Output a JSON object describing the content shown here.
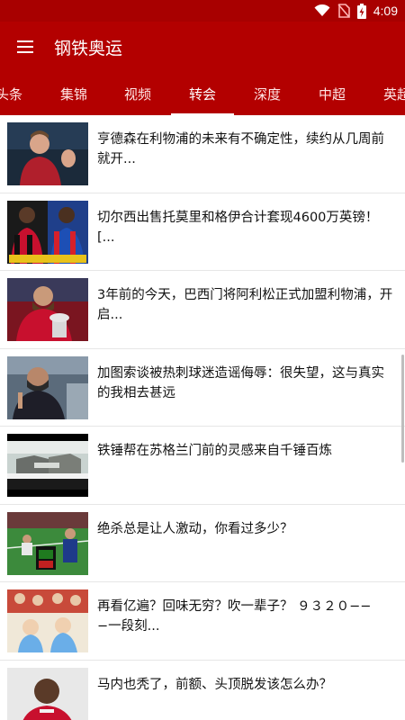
{
  "status_bar": {
    "time": "4:09",
    "icons": [
      "wifi-icon",
      "no-sim-icon",
      "battery-charging-icon"
    ]
  },
  "app_bar": {
    "title": "钢铁奥运",
    "menu_icon": "hamburger-menu-icon"
  },
  "tabs": [
    {
      "label": "头条",
      "active": false
    },
    {
      "label": "集锦",
      "active": false
    },
    {
      "label": "视频",
      "active": false
    },
    {
      "label": "转会",
      "active": true
    },
    {
      "label": "深度",
      "active": false
    },
    {
      "label": "中超",
      "active": false
    },
    {
      "label": "英超",
      "active": false
    }
  ],
  "news": [
    {
      "title": "亨德森在利物浦的未来有不确定性，续约从几周前就开..."
    },
    {
      "title": "切尔西出售托莫里和格伊合计套现4600万英镑！[..."
    },
    {
      "title": "3年前的今天，巴西门将阿利松正式加盟利物浦，开启..."
    },
    {
      "title": "加图索谈被热刺球迷造谣侮辱：很失望，这与真实的我相去甚远"
    },
    {
      "title": "铁锤帮在苏格兰门前的灵感来自千锤百炼"
    },
    {
      "title": "绝杀总是让人激动，你看过多少？"
    },
    {
      "title": "再看亿遍？回味无穷？吹一辈子？ ９３２０−−−一段刻..."
    },
    {
      "title": "马内也秃了，前额、头顶脱发该怎么办？"
    }
  ],
  "colors": {
    "primary": "#b30000",
    "status_bar": "#a80000",
    "divider": "#e6e6e6"
  }
}
